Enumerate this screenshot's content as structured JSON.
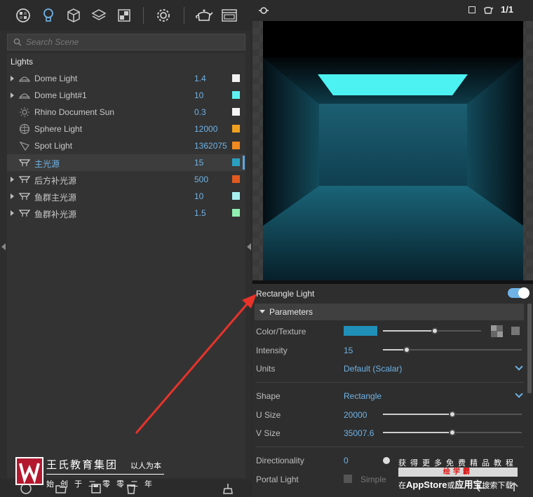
{
  "search": {
    "placeholder": "Search Scene"
  },
  "list": {
    "header": "Lights",
    "items": [
      {
        "name": "Dome Light",
        "value": "1.4",
        "color": "#f2f2f2",
        "icon": "dome-icon",
        "expandable": true
      },
      {
        "name": "Dome Light#1",
        "value": "10",
        "color": "#5ef0f0",
        "icon": "dome-icon",
        "expandable": true
      },
      {
        "name": "Rhino Document Sun",
        "value": "0.3",
        "color": "#f5f5f5",
        "icon": "sun-icon",
        "expandable": false
      },
      {
        "name": "Sphere Light",
        "value": "12000",
        "color": "#f0a020",
        "icon": "sphere-icon",
        "expandable": false
      },
      {
        "name": "Spot Light",
        "value": "1362075",
        "color": "#f08a20",
        "icon": "spot-icon",
        "expandable": false
      },
      {
        "name": "主光源",
        "value": "15",
        "color": "#2aa0c0",
        "icon": "rect-light-icon",
        "expandable": false,
        "selected": true
      },
      {
        "name": "后方补光源",
        "value": "500",
        "color": "#e05a20",
        "icon": "rect-light-icon",
        "expandable": true
      },
      {
        "name": "鱼群主光源",
        "value": "10",
        "color": "#a8f0f0",
        "icon": "rect-light-icon",
        "expandable": true
      },
      {
        "name": "鱼群补光源",
        "value": "1.5",
        "color": "#90f0b0",
        "icon": "rect-light-icon",
        "expandable": true
      }
    ]
  },
  "viewport": {
    "frame_label": "1/1"
  },
  "props": {
    "title": "Rectangle Light",
    "section": "Parameters",
    "color_label": "Color/Texture",
    "color_swatch": "#2090b8",
    "color_slider": 0.53,
    "intensity_label": "Intensity",
    "intensity_value": "15",
    "intensity_slider": 0.17,
    "units_label": "Units",
    "units_value": "Default (Scalar)",
    "shape_label": "Shape",
    "shape_value": "Rectangle",
    "usize_label": "U Size",
    "usize_value": "20000",
    "usize_slider": 0.5,
    "vsize_label": "V Size",
    "vsize_value": "35007.6",
    "vsize_slider": 0.5,
    "directionality_label": "Directionality",
    "directionality_value": "0",
    "portal_label": "Portal Light",
    "portal_value": "Simple"
  },
  "watermark": {
    "title": "王氏教育集团",
    "slogan": "以人为本",
    "sub": "始创于二零零二年"
  },
  "ad": {
    "line1": "获得更多免费精品教程",
    "pill": "绘学霸",
    "line3_pre": "在",
    "line3_brand": "AppStore",
    "line3_mid": "或",
    "line3_app": "应用宝",
    "line3_post": "搜索下载"
  }
}
